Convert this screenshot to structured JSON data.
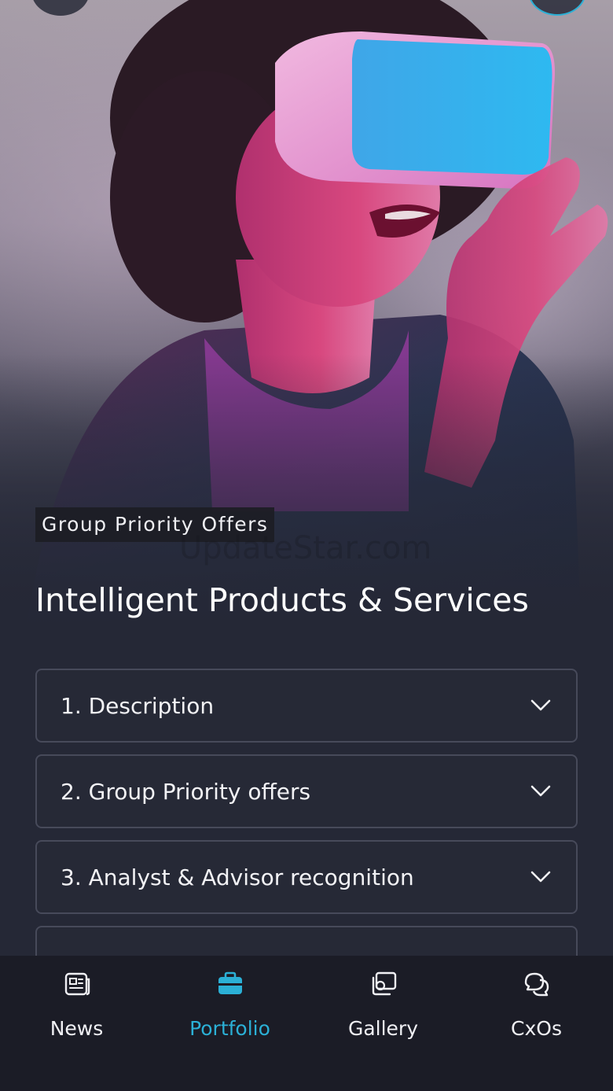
{
  "hero": {
    "tag": "Group Priority Offers",
    "watermark": "UpdateStar.com",
    "title": "Intelligent Products & Services"
  },
  "accordion": {
    "items": [
      {
        "label": "1. Description",
        "icon": "chevron-down-icon"
      },
      {
        "label": "2. Group Priority offers",
        "icon": "chevron-down-icon"
      },
      {
        "label": "3. Analyst & Advisor recognition",
        "icon": "chevron-down-icon"
      }
    ]
  },
  "bottom_nav": {
    "items": [
      {
        "label": "News",
        "icon": "newspaper-icon",
        "active": false
      },
      {
        "label": "Portfolio",
        "icon": "briefcase-icon",
        "active": true
      },
      {
        "label": "Gallery",
        "icon": "gallery-icon",
        "active": false
      },
      {
        "label": "CxOs",
        "icon": "chat-bubbles-icon",
        "active": false
      }
    ]
  },
  "colors": {
    "accent": "#2bb0d6",
    "background": "#252836",
    "nav_background": "#1b1c26",
    "card_border": "#474a5a"
  }
}
